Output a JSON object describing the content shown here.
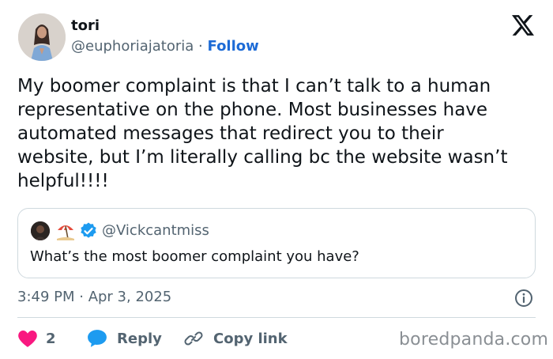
{
  "author": {
    "name": "tori",
    "handle": "@euphoriajatoria",
    "separator": "·",
    "follow_label": "Follow"
  },
  "logo_icon": "x-logo-icon",
  "tweet": {
    "text": "My boomer complaint is that I can’t talk to a human representative on the phone. Most businesses have automated messages that redirect you to their website, but I’m literally calling bc the website wasn’t helpful!!!!"
  },
  "quote": {
    "avatar_icon": "avatar",
    "emoji_icon": "beach-umbrella-icon",
    "verified_icon": "verified-badge-icon",
    "handle": "@Vickcantmiss",
    "text": "What’s the most boomer complaint you have?"
  },
  "timestamp": "3:49 PM · Apr 3, 2025",
  "actions": {
    "like_count": "2",
    "reply_label": "Reply",
    "copy_label": "Copy link"
  },
  "watermark": "boredpanda.com",
  "colors": {
    "like": "#f91880",
    "reply": "#1d9bf0",
    "follow": "#1d6bd6",
    "muted": "#536471",
    "border": "#cfd9de"
  }
}
